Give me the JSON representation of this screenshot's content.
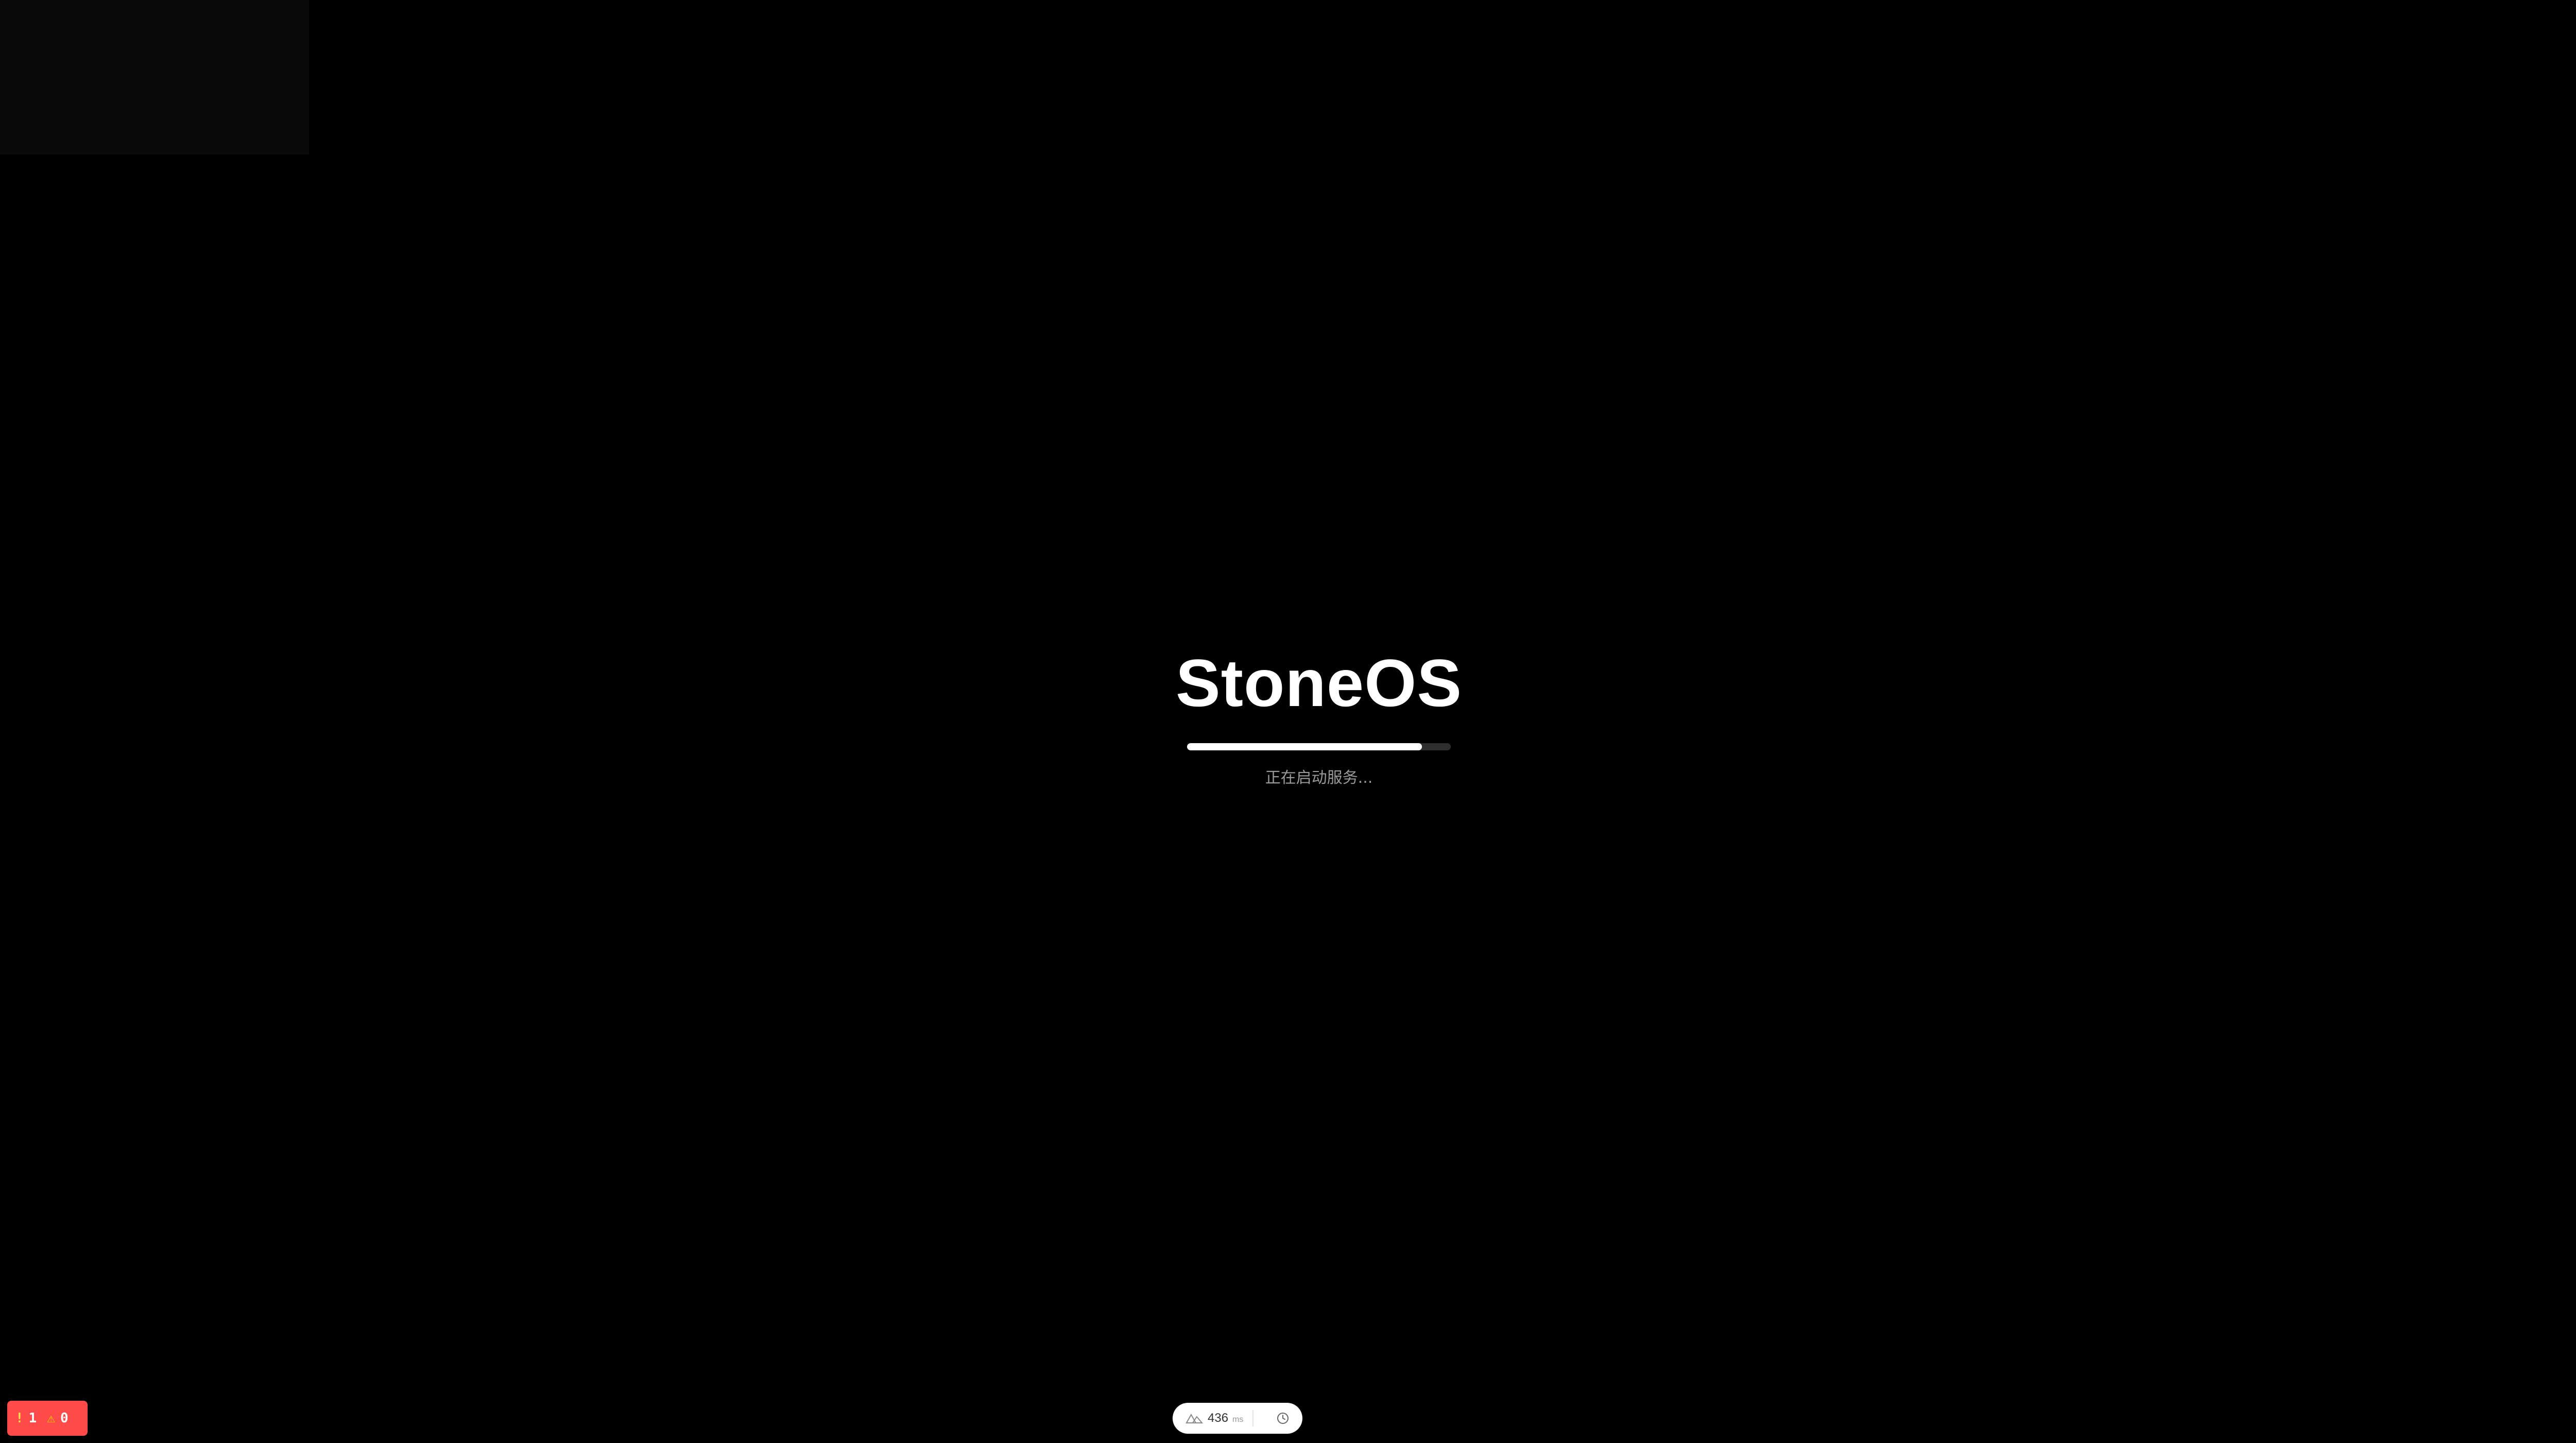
{
  "splash": {
    "brand": "StoneOS",
    "progress_percent": 89,
    "status": "正在启动服务..."
  },
  "dev_indicator": {
    "route_icon": "route-icon",
    "timing_value": "436",
    "timing_unit": "ms",
    "clock_icon": "clock-icon"
  },
  "issues": {
    "error_icon": "exclamation-icon",
    "error_count": "1",
    "warning_icon": "warning-icon",
    "warning_count": "0"
  },
  "colors": {
    "background": "#000000",
    "progress_fill": "#ffffff",
    "progress_track": "#2e2e2e",
    "status_text": "#9a9a9a",
    "issues_badge": "#ff4a4a"
  }
}
